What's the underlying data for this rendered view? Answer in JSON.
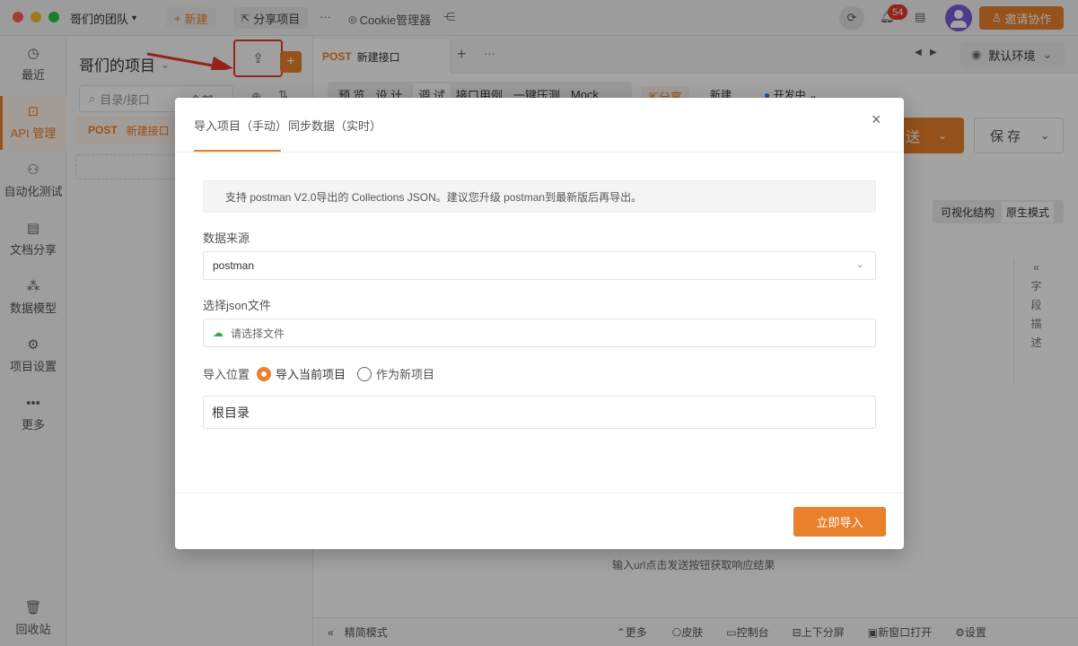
{
  "titlebar": {
    "team": "哥们的团队",
    "new_label": "新建",
    "share_label": "分享项目",
    "more": "···",
    "cookie_label": "Cookie管理器",
    "badge": "54",
    "invite_label": "邀请协作"
  },
  "rail": {
    "items": [
      {
        "label": "最近",
        "icon": "clock-icon"
      },
      {
        "label": "API 管理",
        "icon": "api-icon"
      },
      {
        "label": "自动化测试",
        "icon": "flow-icon"
      },
      {
        "label": "文档分享",
        "icon": "doc-icon"
      },
      {
        "label": "数据模型",
        "icon": "model-icon"
      },
      {
        "label": "项目设置",
        "icon": "settings-icon"
      },
      {
        "label": "更多",
        "icon": "more-icon"
      }
    ],
    "trash": "回收站"
  },
  "project": {
    "title": "哥们的项目",
    "search_placeholder": "目录/接口",
    "filter": "全部",
    "item_method": "POST",
    "item_name": "新建接口"
  },
  "main": {
    "tab_method": "POST",
    "tab_name": "新建接口",
    "env": "默认环境",
    "subtabs": [
      "预 览",
      "设 计",
      "调 试",
      "接口用例",
      "一键压测",
      "Mock"
    ],
    "share": "分享",
    "new_short": "新建",
    "status": "开发中",
    "send": "送",
    "save": "保 存",
    "mode_visual": "可视化结构",
    "mode_raw": "原生模式",
    "side_text": [
      "字",
      "段",
      "描",
      "述"
    ],
    "hint": "输入url点击发送按钮获取响应结果",
    "bottom": {
      "simple": "精简模式",
      "more": "更多",
      "skin": "皮肤",
      "console": "控制台",
      "split": "上下分屏",
      "new_window": "新窗口打开",
      "settings": "设置"
    }
  },
  "modal": {
    "tabs": [
      "导入项目（手动）",
      "同步数据（实时）"
    ],
    "notice": "支持 postman V2.0导出的 Collections JSON。建议您升级 postman到最新版后再导出。",
    "source_label": "数据来源",
    "source_value": "postman",
    "file_label": "选择json文件",
    "file_placeholder": "请选择文件",
    "position_label": "导入位置",
    "option1": "导入当前项目",
    "option2": "作为新项目",
    "folder": "根目录",
    "submit": "立即导入"
  },
  "colors": {
    "accent": "#e9802b",
    "annotation": "#e8392a"
  }
}
